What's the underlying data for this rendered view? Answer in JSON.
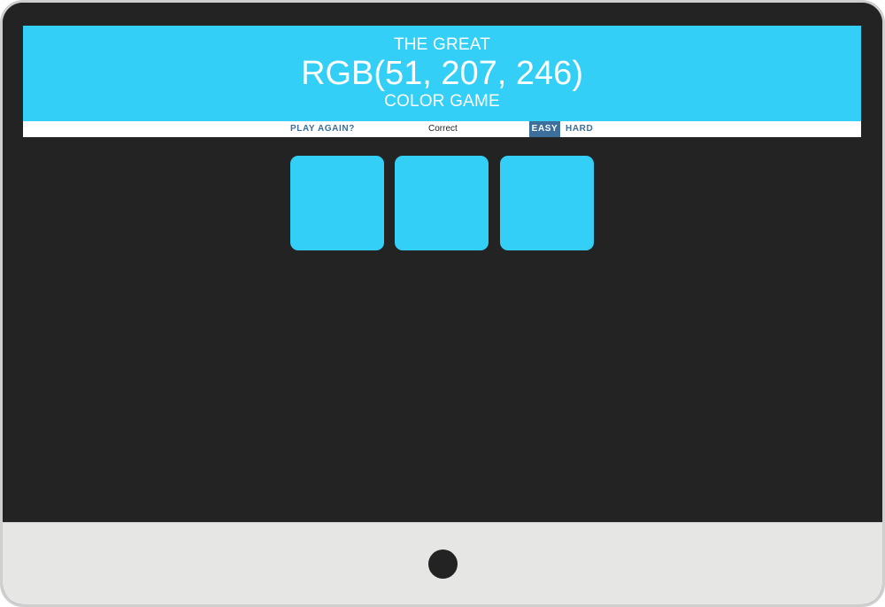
{
  "header": {
    "title_top": "THE GREAT",
    "rgb_display": "RGB(51, 207, 246)",
    "title_bottom": "COLOR GAME",
    "background_color": "#33cff6"
  },
  "controls": {
    "play_again_label": "PLAY AGAIN?",
    "message": "Correct",
    "modes": [
      {
        "label": "EASY",
        "selected": true
      },
      {
        "label": "HARD",
        "selected": false
      }
    ],
    "accent_color": "#3c6f9c"
  },
  "squares": [
    {
      "color": "#33cff6"
    },
    {
      "color": "#33cff6"
    },
    {
      "color": "#33cff6"
    }
  ],
  "page": {
    "background_color": "#232323"
  }
}
